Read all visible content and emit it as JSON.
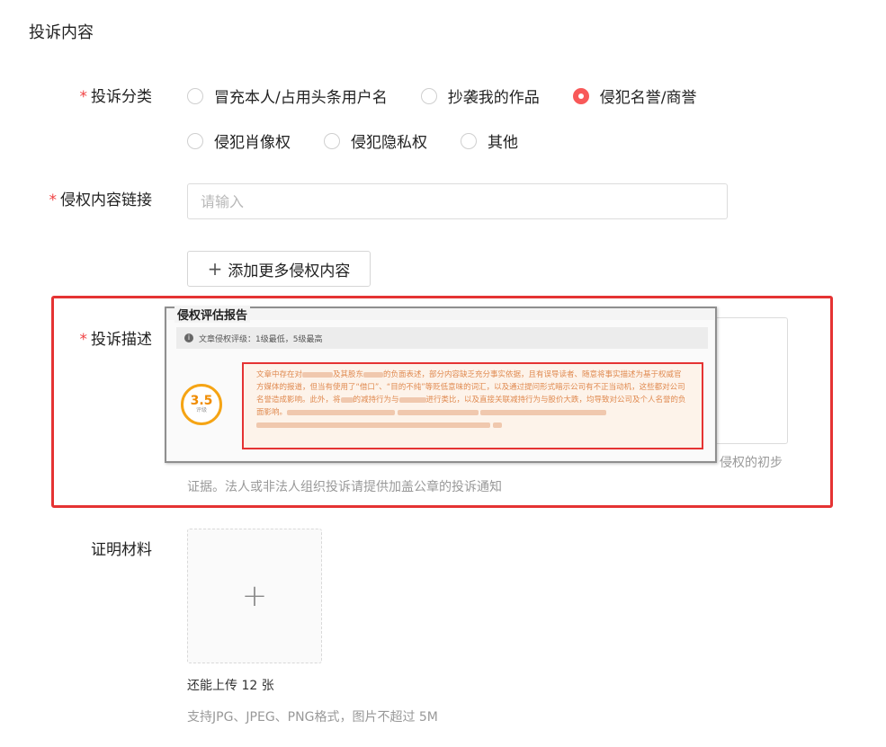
{
  "section_title": "投诉内容",
  "fields": {
    "category": {
      "required_mark": "*",
      "label": "投诉分类",
      "options": [
        {
          "label": "冒充本人/占用头条用户名",
          "checked": false
        },
        {
          "label": "抄袭我的作品",
          "checked": false
        },
        {
          "label": "侵犯名誉/商誉",
          "checked": true
        },
        {
          "label": "侵犯肖像权",
          "checked": false
        },
        {
          "label": "侵犯隐私权",
          "checked": false
        },
        {
          "label": "其他",
          "checked": false
        }
      ]
    },
    "link": {
      "required_mark": "*",
      "label": "侵权内容链接",
      "value": "",
      "placeholder": "请输入",
      "add_more_label": "添加更多侵权内容"
    },
    "description": {
      "required_mark": "*",
      "label": "投诉描述",
      "hint_tail": "侵权的初步",
      "hint_line2": "证据。法人或非法人组织投诉请提供加盖公章的投诉通知"
    },
    "evidence": {
      "label": "证明材料",
      "remaining": "还能上传 12 张",
      "format_hint": "支持JPG、JPEG、PNG格式，图片不超过 5M"
    }
  },
  "report_image": {
    "title": "侵权评估报告",
    "info_text": "文章侵权评级：1级最低，5级最高",
    "score": "3.5",
    "score_caption": "评级",
    "text_parts": [
      "文章中存在对",
      "及其股东",
      "的负面表述，部分内容缺乏充分事实依据，且有误导读者、随意将事实描述为基于权威官方媒体的报道，但当有使用了“借口”、“目的不纯”等贬低意味的词汇，以及通过提问形式暗示公司有不正当动机，这些都对公司名誉造成影响。此外，将",
      "的减持行为与",
      "进行类比，以及直接关联减持行为与股价大跌，均导致对公司及个人名誉的负面影响。"
    ]
  },
  "colors": {
    "accent": "#f85959",
    "required": "#f04142",
    "highlight_frame": "#e53333",
    "score_ring": "#f5a414"
  },
  "icons": {
    "info": "info-icon",
    "add": "plus-icon",
    "upload": "plus-icon"
  }
}
